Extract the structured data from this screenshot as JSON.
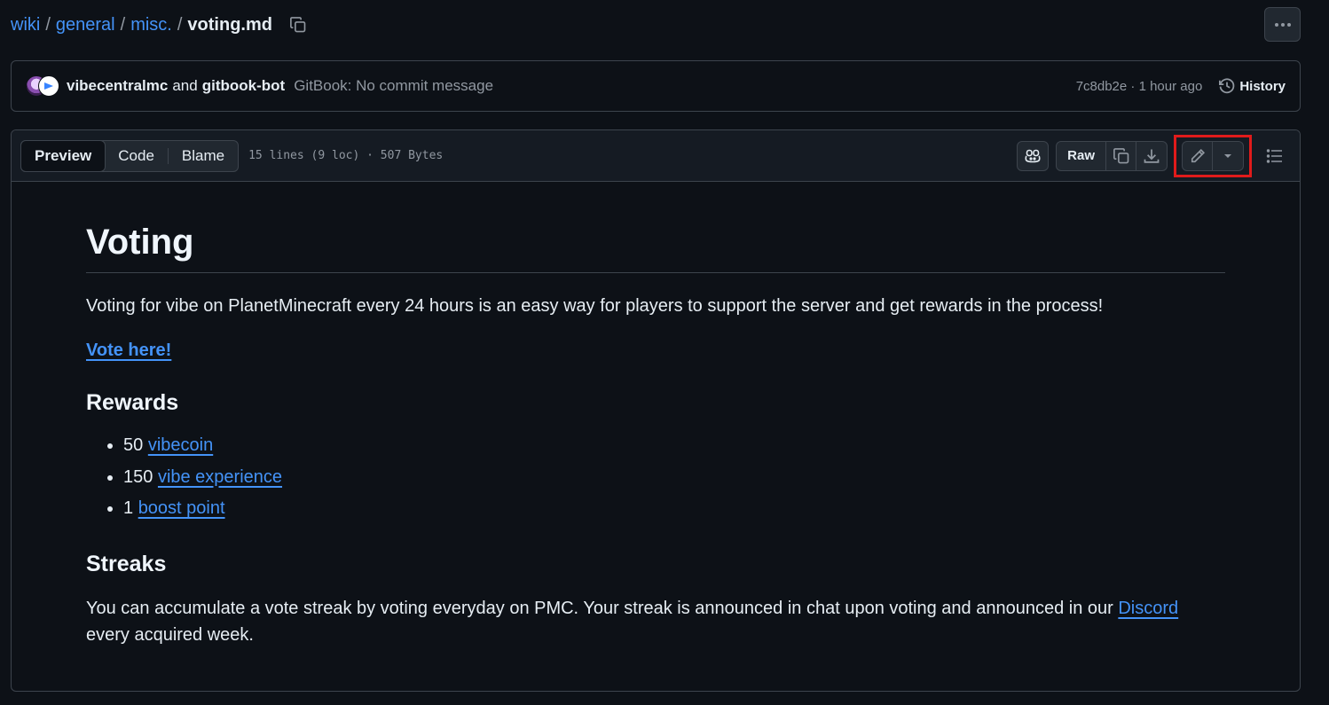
{
  "breadcrumb": {
    "parts": [
      "wiki",
      "general",
      "misc."
    ],
    "separator": "/",
    "file": "voting.md"
  },
  "commit": {
    "author1": "vibecentralmc",
    "and": "and",
    "author2": "gitbook-bot",
    "message": "GitBook: No commit message",
    "sha_time": "7c8db2e · 1 hour ago",
    "history_label": "History"
  },
  "file_header": {
    "tabs": [
      "Preview",
      "Code",
      "Blame"
    ],
    "active_tab": "Preview",
    "info": "15 lines (9 loc) · 507 Bytes",
    "raw_label": "Raw"
  },
  "content": {
    "title": "Voting",
    "intro": "Voting for vibe on PlanetMinecraft every 24 hours is an easy way for players to support the server and get rewards in the process!",
    "vote_link": "Vote here!",
    "rewards_heading": "Rewards",
    "rewards": [
      {
        "amount": "50",
        "link": "vibecoin"
      },
      {
        "amount": "150",
        "link": "vibe experience"
      },
      {
        "amount": "1",
        "link": "boost point"
      }
    ],
    "streaks_heading": "Streaks",
    "streaks_text": "You can accumulate a vote streak by voting everyday on PMC. Your streak is announced in chat upon voting and announced in our",
    "discord_link": "Discord",
    "streaks_tail": "every acquired week."
  },
  "colors": {
    "background": "#0d1117",
    "link": "#4493f8",
    "border": "#3d444d",
    "highlight": "#e01b1b"
  }
}
